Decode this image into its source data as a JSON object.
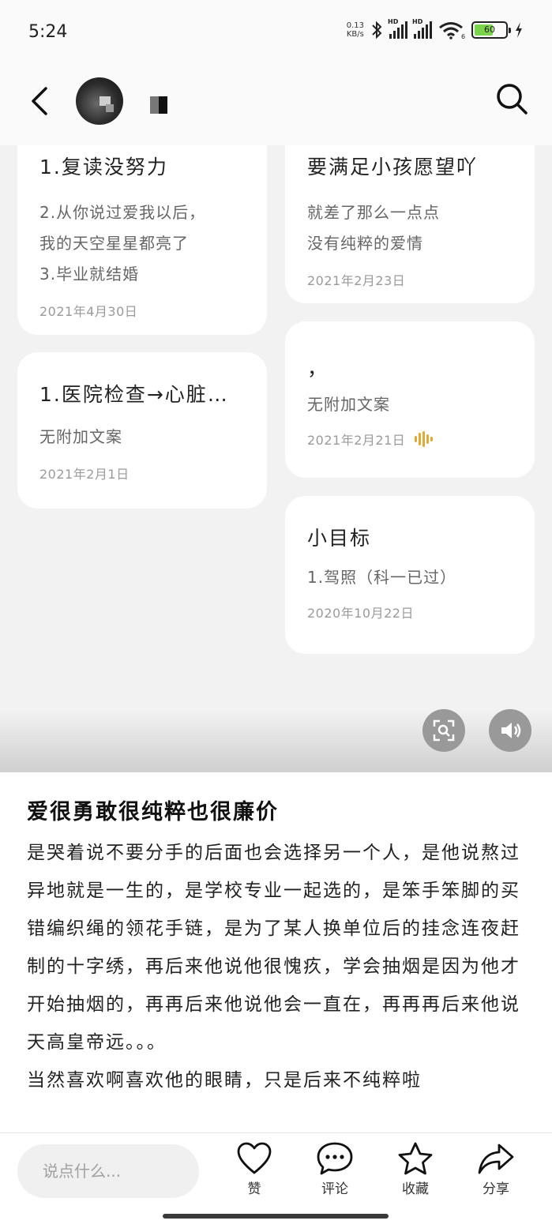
{
  "status_bar": {
    "time": "5:24",
    "net_speed_value": "0.13",
    "net_speed_unit": "KB/s",
    "signal1_label": "HD",
    "signal2_label": "HD",
    "wifi_badge": "6",
    "battery": "60"
  },
  "header": {
    "back_icon": "chevron-left-icon",
    "search_icon": "search-icon"
  },
  "cards": [
    {
      "title": "1.复读没努力",
      "body": [
        "2.从你说过爱我以后，",
        "我的天空星星都亮了",
        "3.毕业就结婚"
      ],
      "date": "2021年4月30日",
      "has_voice": false
    },
    {
      "title": "要满足小孩愿望吖",
      "body": [
        "就差了那么一点点",
        "没有纯粹的爱情"
      ],
      "date": "2021年2月23日",
      "has_voice": false
    },
    {
      "title": "1.医院检查→心脏…",
      "body": [
        "无附加文案"
      ],
      "date": "2021年2月1日",
      "has_voice": false
    },
    {
      "title": "，",
      "body": [
        "无附加文案"
      ],
      "date": "2021年2月21日",
      "has_voice": true
    },
    {
      "title": "小目标",
      "body": [
        "1.驾照（科一已过）"
      ],
      "date": "2020年10月22日",
      "has_voice": false
    }
  ],
  "float_buttons": {
    "scan_icon": "screenshot-scan-icon",
    "sound_icon": "speaker-icon"
  },
  "post": {
    "title": "爱很勇敢很纯粹也很廉价",
    "body": "是哭着说不要分手的后面也会选择另一个人，是他说熬过异地就是一生的，是学校专业一起选的，是笨手笨脚的买错编织绳的领花手链，是为了某人换单位后的挂念连夜赶制的十字绣，再后来他说他很愧疚，学会抽烟是因为他才开始抽烟的，再再后来他说他会一直在，再再再后来他说天高皇帝远。。。\n当然喜欢啊喜欢他的眼睛，只是后来不纯粹啦"
  },
  "bottom_bar": {
    "comment_placeholder": "说点什么...",
    "like_label": "赞",
    "comment_label": "评论",
    "favorite_label": "收藏",
    "share_label": "分享"
  }
}
